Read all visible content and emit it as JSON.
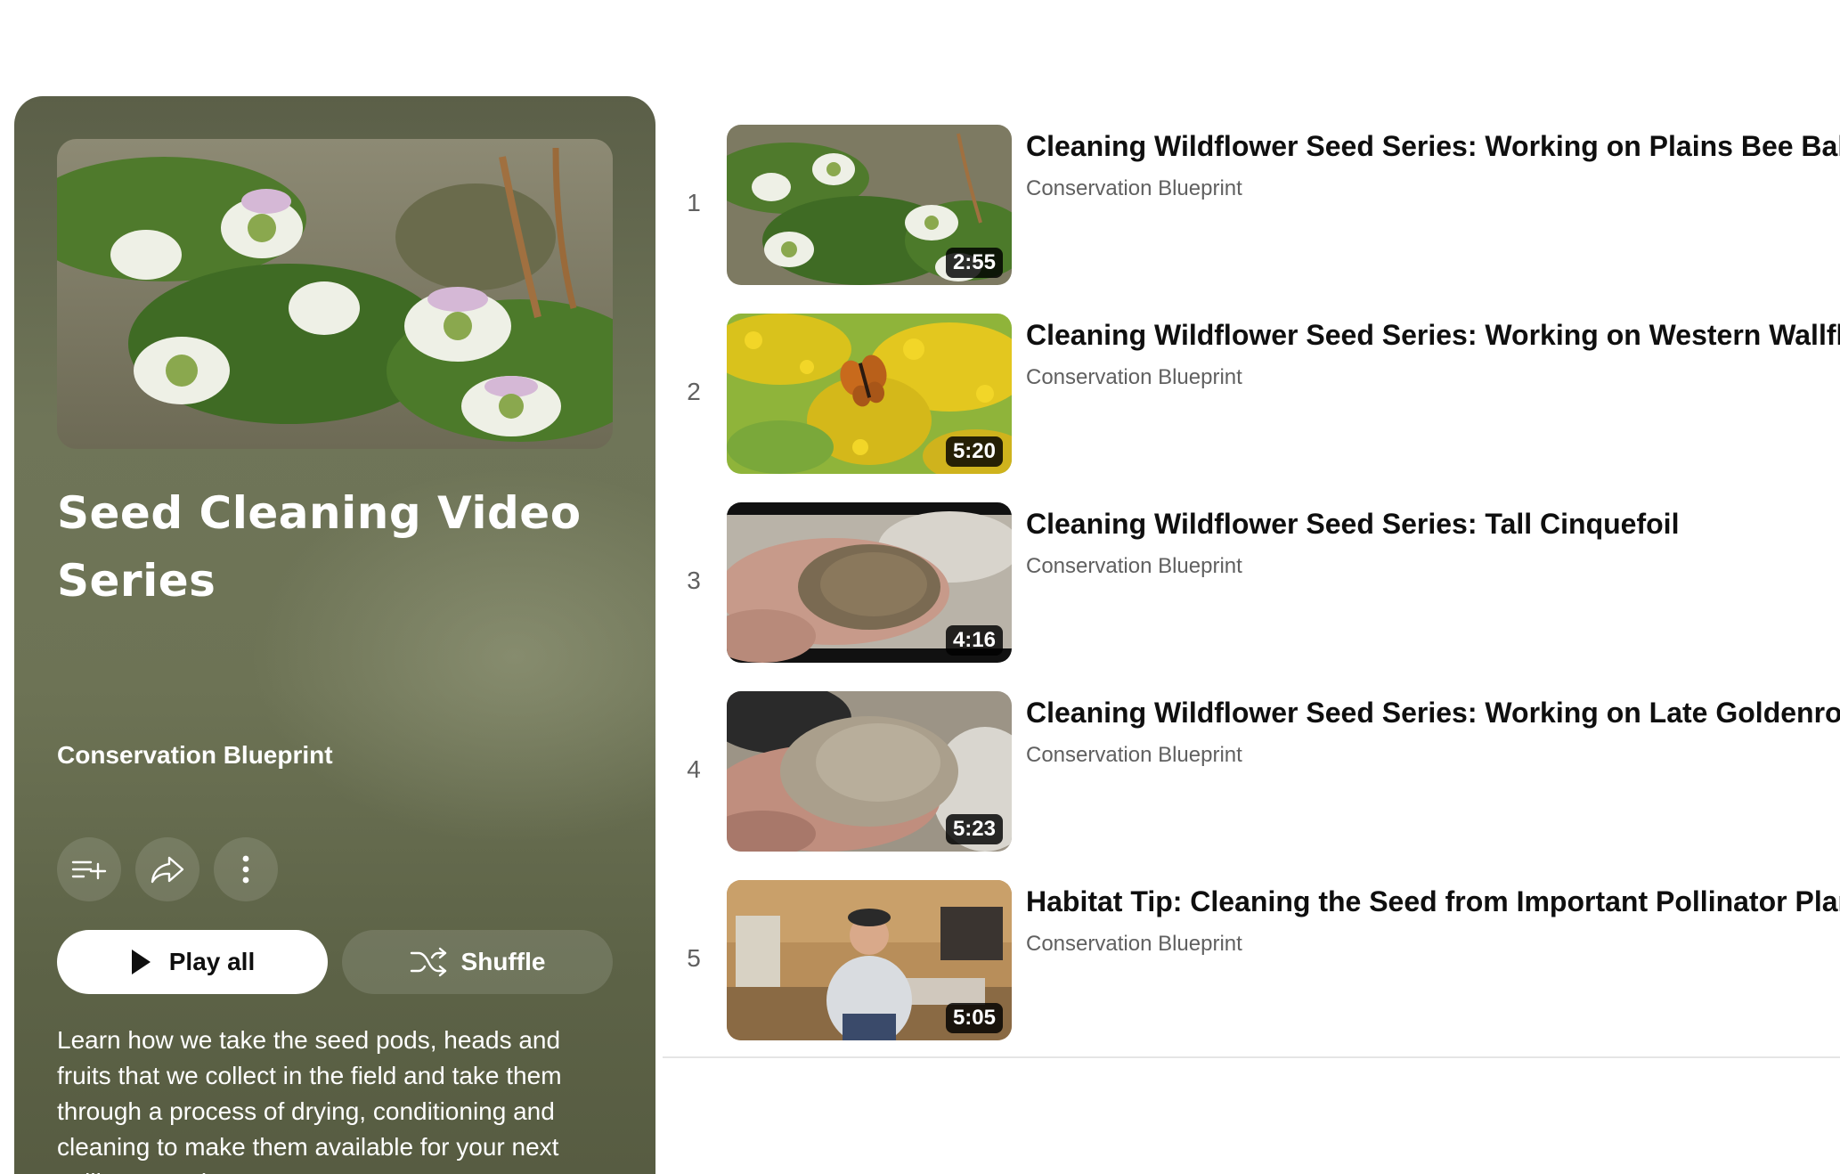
{
  "colors": {
    "panel": "#6d7355",
    "text_primary": "#0f0f0f",
    "text_secondary": "#606060",
    "duration_badge": "#000000"
  },
  "playlist": {
    "title": "Seed Cleaning Video Series",
    "channel": "Conservation Blueprint",
    "thumbnail_icon": "bee-balm-flowers-thumbnail",
    "buttons": {
      "save_icon": "playlist-add-icon",
      "share_icon": "share-icon",
      "more_icon": "more-vert-icon",
      "play_all": "Play all",
      "shuffle": "Shuffle"
    },
    "description": "Learn how we take the seed pods, heads and fruits that we collect in the field and take them through a process of drying, conditioning and cleaning to make them available for your next pollinator project."
  },
  "videos": [
    {
      "index": "1",
      "title": "Cleaning Wildflower Seed Series: Working on Plains Bee Balm",
      "channel": "Conservation Blueprint",
      "duration": "2:55",
      "thumbnail": "bee-balm-flowers"
    },
    {
      "index": "2",
      "title": "Cleaning Wildflower Seed Series: Working on Western Wallflower",
      "channel": "Conservation Blueprint",
      "duration": "5:20",
      "thumbnail": "butterfly-on-goldenrod"
    },
    {
      "index": "3",
      "title": "Cleaning Wildflower Seed Series: Tall Cinquefoil",
      "channel": "Conservation Blueprint",
      "duration": "4:16",
      "thumbnail": "seed-in-hand"
    },
    {
      "index": "4",
      "title": "Cleaning Wildflower Seed Series: Working on Late Goldenrod",
      "channel": "Conservation Blueprint",
      "duration": "5:23",
      "thumbnail": "fluffy-seed-in-hand"
    },
    {
      "index": "5",
      "title": "Habitat Tip: Cleaning the Seed from Important Pollinator Plants",
      "channel": "Conservation Blueprint",
      "duration": "5:05",
      "thumbnail": "man-in-workshop"
    }
  ]
}
